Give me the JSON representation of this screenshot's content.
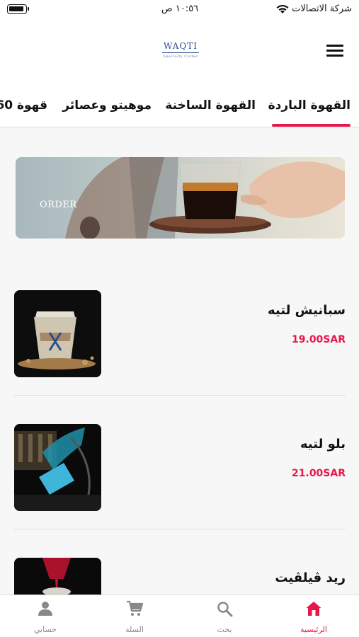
{
  "status_bar": {
    "carrier": "شركة الاتصالات",
    "time": "١٠:٥٦ ص"
  },
  "header": {
    "logo_brand": "WAQTI",
    "logo_sub": "Specialty Coffee",
    "menu_icon": "hamburger-menu-icon"
  },
  "tabs": [
    {
      "label": "القهوة الباردة",
      "active": true
    },
    {
      "label": "القهوة الساخنة",
      "active": false
    },
    {
      "label": "موهيتو وعصائر",
      "active": false
    },
    {
      "label": "قهوة 60",
      "active": false
    }
  ],
  "banner": {
    "text": "ORDER"
  },
  "products": [
    {
      "name": "سبانيش لتيه",
      "price": "19.00SAR"
    },
    {
      "name": "بلو لتيه",
      "price": "21.00SAR"
    },
    {
      "name": "ريد ڤيلڤيت",
      "price": ""
    }
  ],
  "bottom_nav": {
    "items": [
      {
        "label": "الرئيسية",
        "icon": "home-icon",
        "active": true
      },
      {
        "label": "بحث",
        "icon": "search-icon",
        "active": false
      },
      {
        "label": "السلة",
        "icon": "cart-icon",
        "active": false
      },
      {
        "label": "حسابي",
        "icon": "account-icon",
        "active": false
      }
    ]
  },
  "colors": {
    "accent": "#e8174b",
    "inactive": "#888888",
    "brand_blue": "#2a4f8a"
  }
}
